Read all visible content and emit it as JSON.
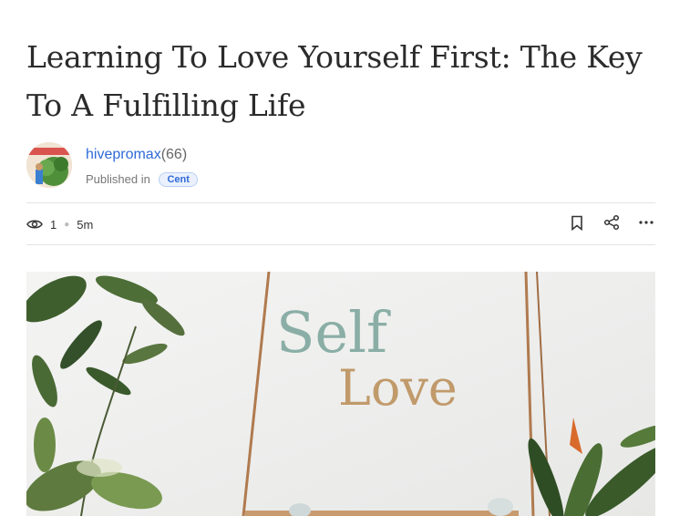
{
  "article": {
    "title": "Learning To Love Yourself First: The Key To A Fulfilling Life"
  },
  "author": {
    "name": "hivepromax",
    "reputation": "(66)",
    "published_label": "Published in",
    "community": "Cent"
  },
  "stats": {
    "views": "1",
    "read_time": "5m"
  },
  "icons": {
    "views": "eye-icon",
    "bookmark": "bookmark-icon",
    "share": "share-icon",
    "more": "more-horizontal-icon"
  },
  "hero": {
    "line1": "Self",
    "line2": "Love"
  },
  "colors": {
    "link": "#2f6ad8",
    "divider": "#e3e3e3"
  }
}
